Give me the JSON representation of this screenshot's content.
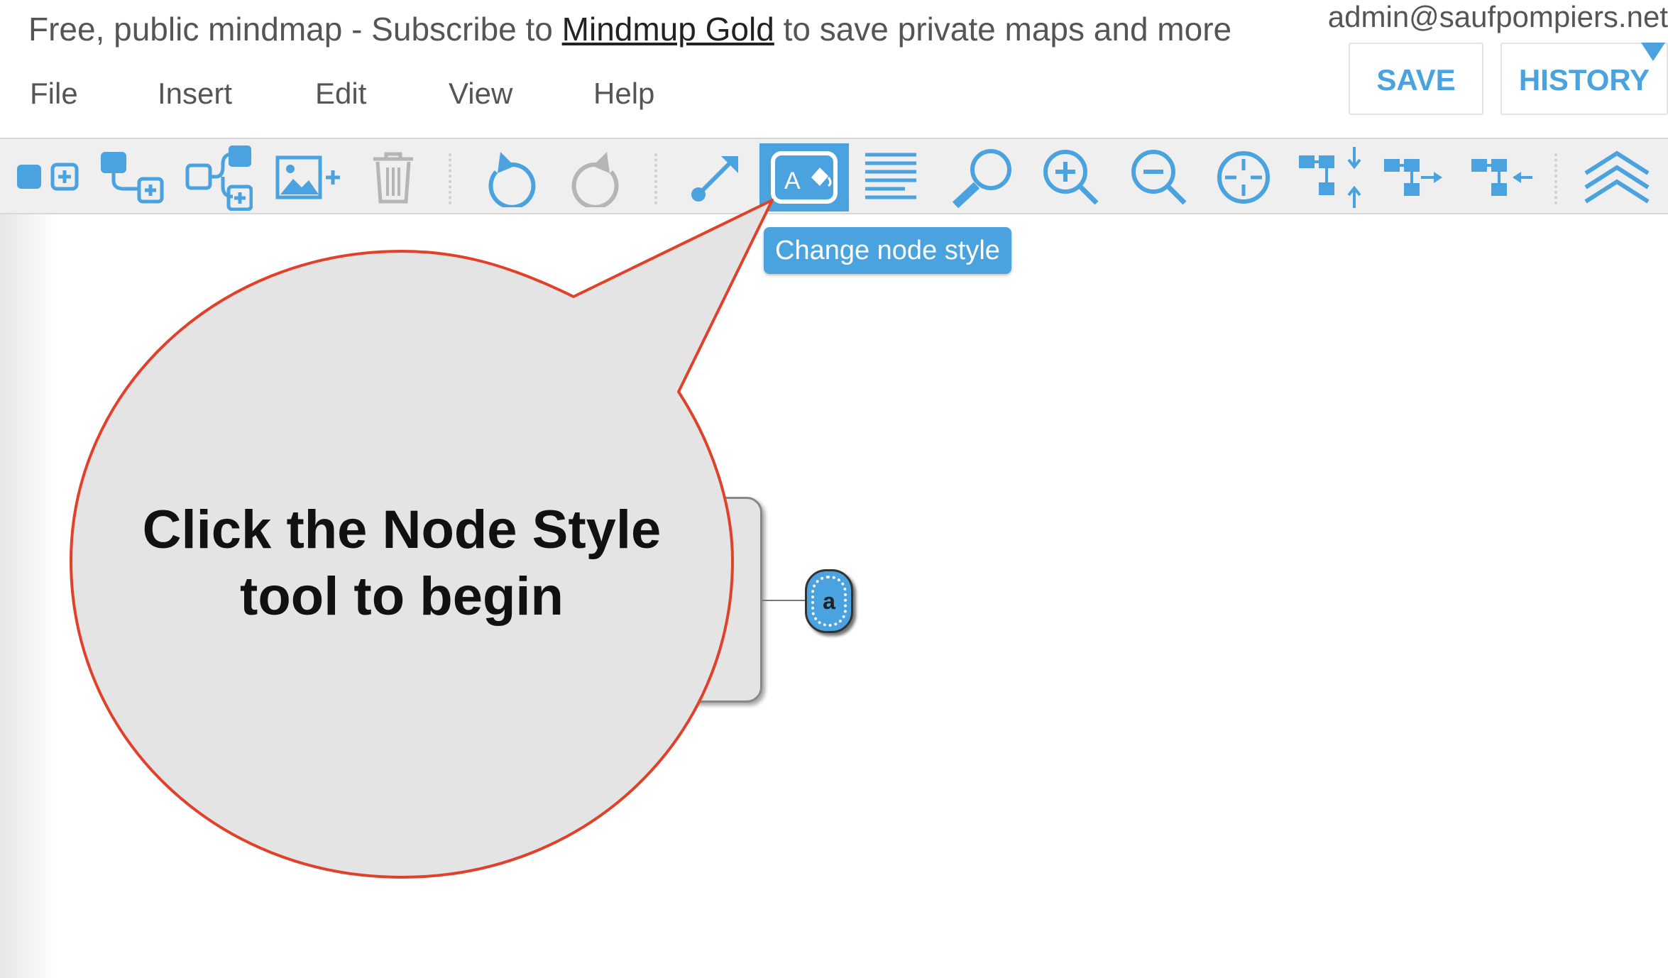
{
  "header": {
    "banner_prefix": "Free, public mindmap - Subscribe to ",
    "banner_link": "Mindmup Gold",
    "banner_suffix": " to save private maps and more",
    "account": "admin@saufpompiers.net",
    "save_label": "SAVE",
    "history_label": "HISTORY"
  },
  "menu": {
    "file": "File",
    "insert": "Insert",
    "edit": "Edit",
    "view": "View",
    "help": "Help"
  },
  "toolbar": {
    "tooltip": "Change node style"
  },
  "canvas": {
    "child_node_label": "a"
  },
  "callout": {
    "line1": "Click the Node Style",
    "line2": "tool to begin"
  },
  "colors": {
    "accent": "#4aa3df",
    "callout_border": "#e0412b",
    "callout_fill": "#e4e4e4"
  }
}
